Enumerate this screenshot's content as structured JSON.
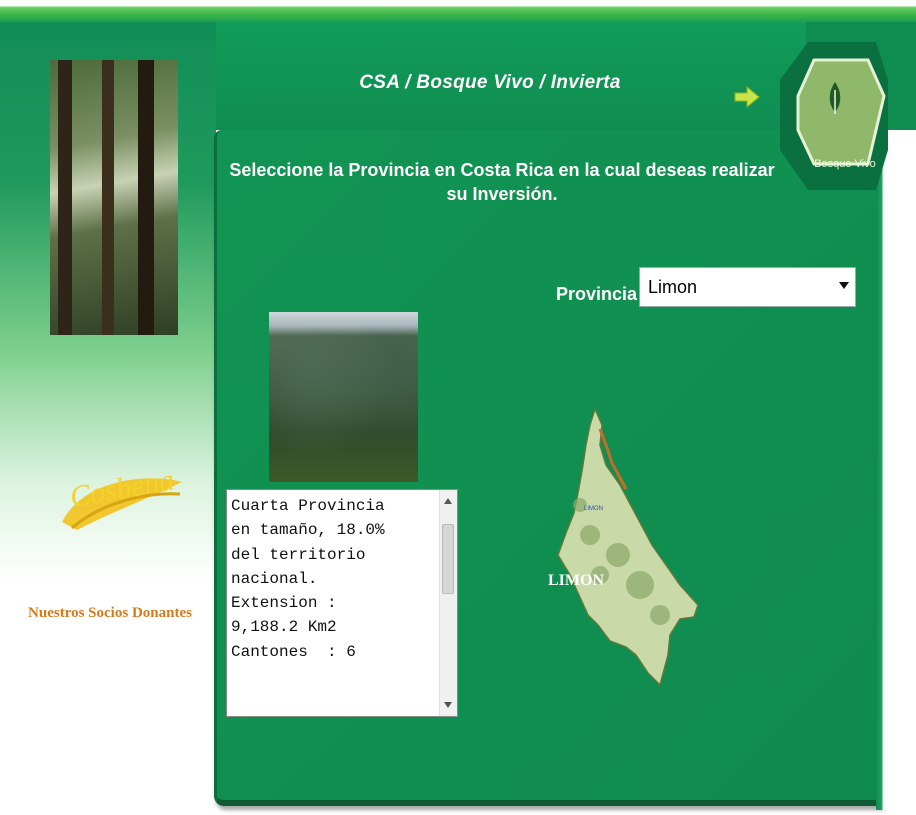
{
  "header": {
    "breadcrumb": "CSA / Bosque Vivo / Invierta",
    "brand_label": "Bosque Vivo"
  },
  "sidebar": {
    "logo_text": "Cosbena",
    "partners_link": "Nuestros Socios Donantes"
  },
  "main": {
    "instruction_line1": "Seleccione la Provincia en Costa Rica en la cual deseas realizar",
    "instruction_line2": "su Inversión.",
    "province_label": "Provincia",
    "province_selected": "Limon",
    "info_text": "Cuarta Provincia\nen tamaño, 18.0%\ndel territorio\nnacional.\nExtension :\n9,188.2 Km2\nCantones  : 6",
    "map_label": "LIMON",
    "map_small_label": "LIMON"
  },
  "colors": {
    "panel_green": "#119453",
    "accent_orange": "#d97a1a",
    "logo_yellow": "#f2c21b"
  },
  "icons": [
    "forward-arrow-icon",
    "leaf-icon"
  ]
}
